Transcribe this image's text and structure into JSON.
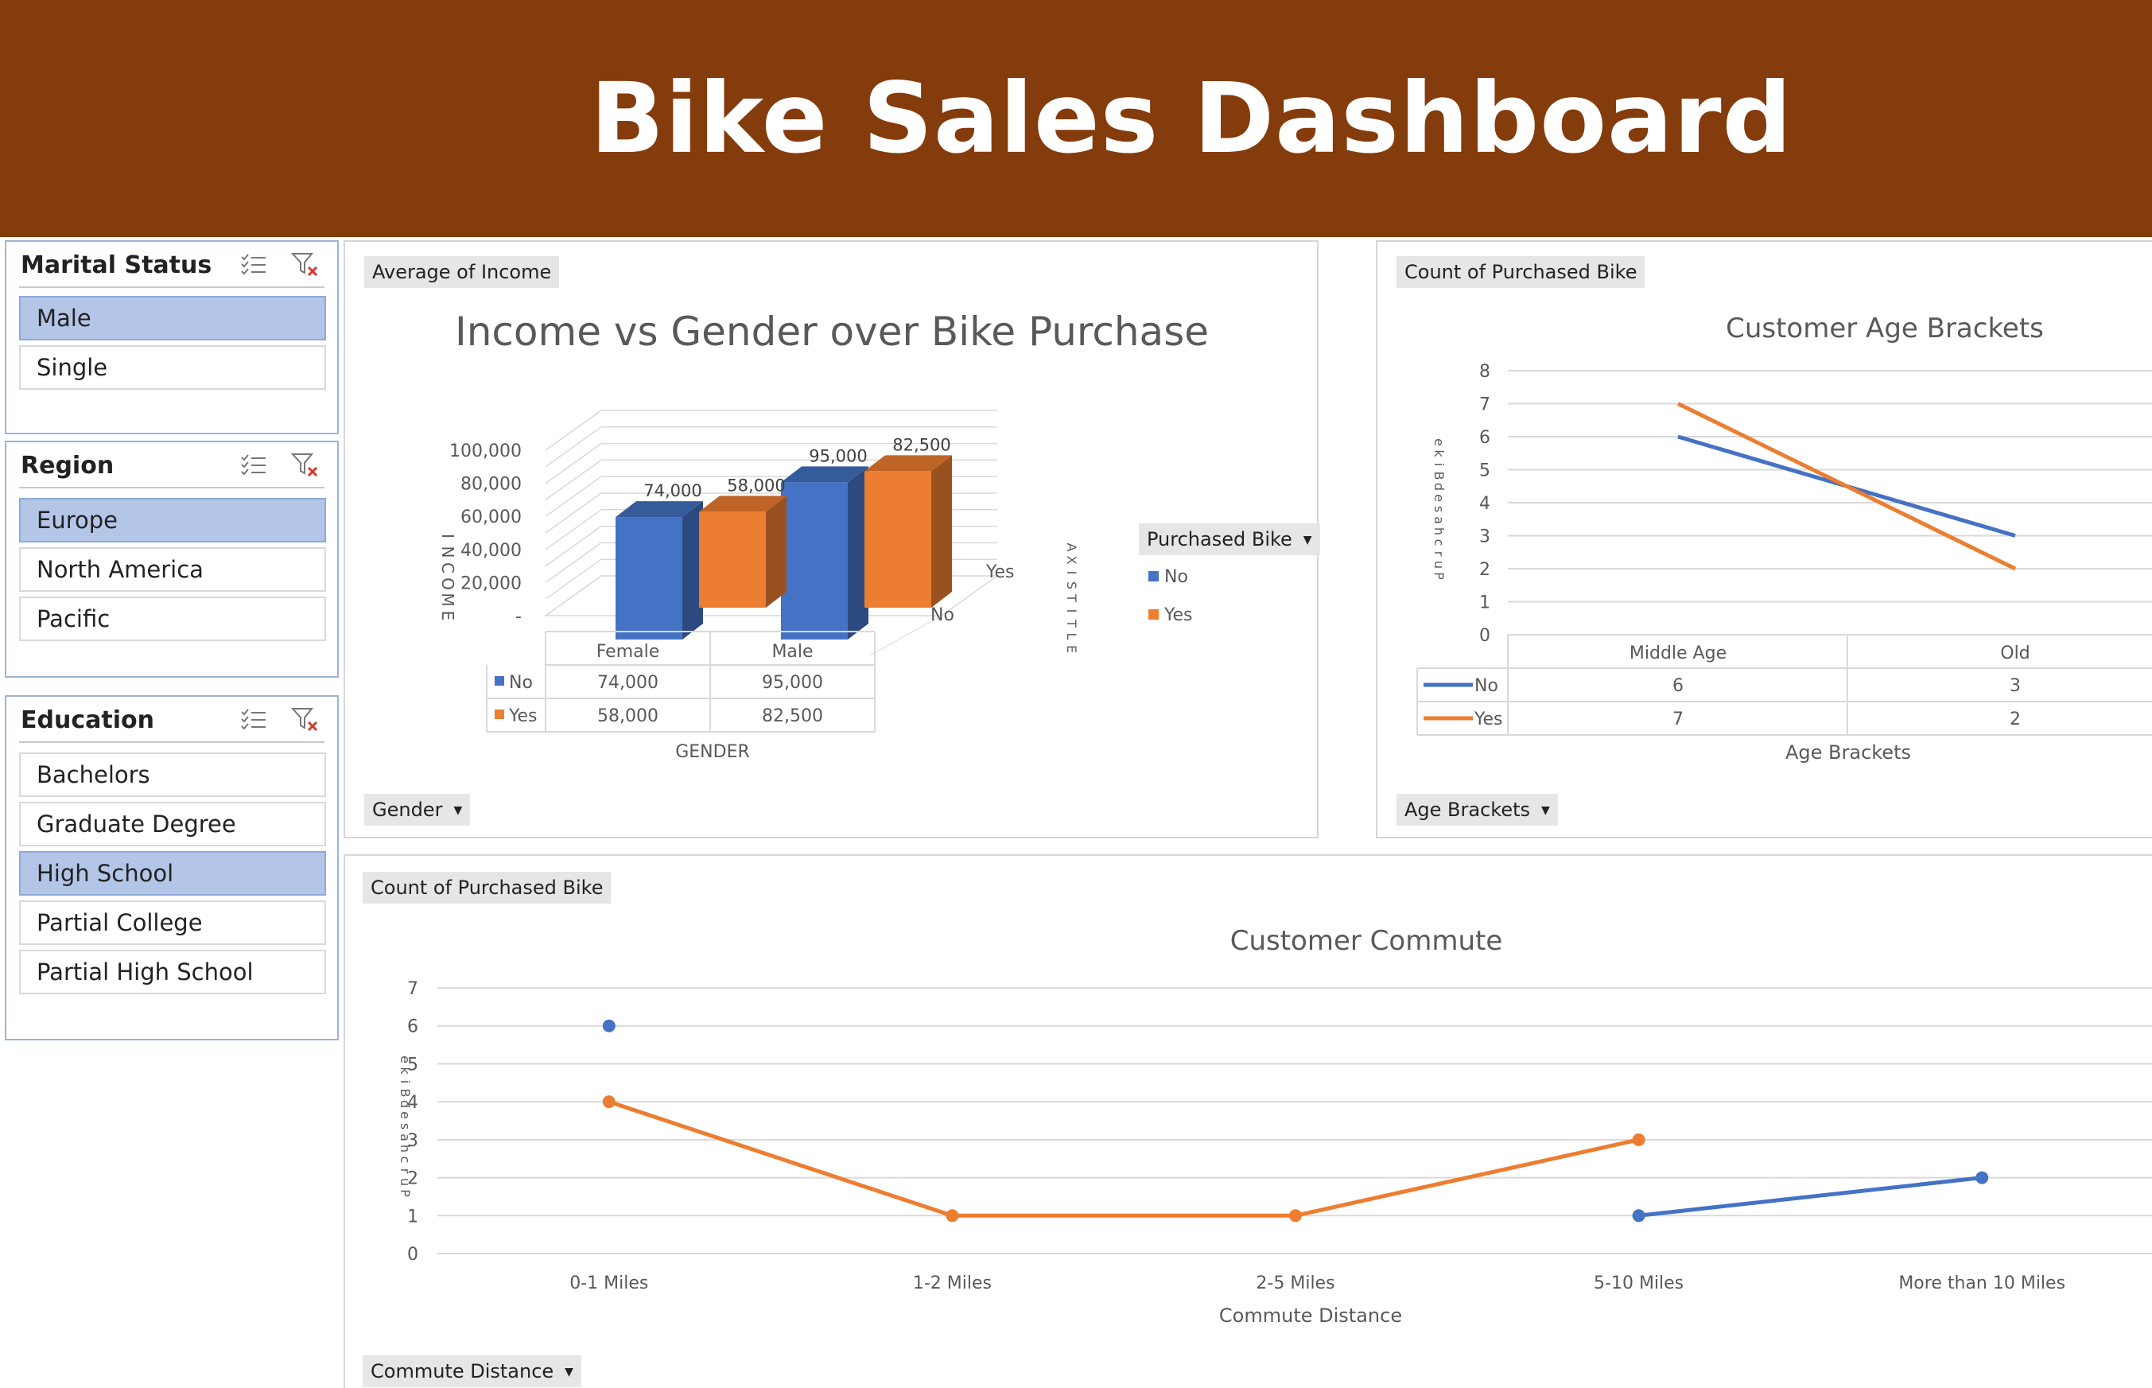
{
  "header": {
    "title": "Bike Sales Dashboard"
  },
  "slicers": {
    "marital_status": {
      "title": "Marital Status",
      "items": [
        {
          "label": "Male",
          "selected": true
        },
        {
          "label": "Single",
          "selected": false
        }
      ]
    },
    "region": {
      "title": "Region",
      "items": [
        {
          "label": "Europe",
          "selected": true
        },
        {
          "label": "North America",
          "selected": false
        },
        {
          "label": "Pacific",
          "selected": false
        }
      ]
    },
    "education": {
      "title": "Education",
      "items": [
        {
          "label": "Bachelors",
          "selected": false
        },
        {
          "label": "Graduate Degree",
          "selected": false
        },
        {
          "label": "High School",
          "selected": true
        },
        {
          "label": "Partial College",
          "selected": false
        },
        {
          "label": "Partial High School",
          "selected": false
        }
      ]
    }
  },
  "income_panel": {
    "value_button": "Average of Income",
    "axis_button": "Gender",
    "legend_button": "Purchased Bike",
    "title": "Income vs Gender over Bike Purchase",
    "y_axis_label": "INCOME",
    "x_axis_label": "GENDER",
    "series_axis_label": "AXIS TITLE",
    "y_ticks": [
      "100,000",
      "80,000",
      "60,000",
      "40,000",
      "20,000",
      "-"
    ],
    "depth_labels": [
      "Yes",
      "No"
    ],
    "table_header": [
      "Female",
      "Male"
    ],
    "table_rows": [
      {
        "name": "No",
        "values": [
          "74,000",
          "95,000"
        ]
      },
      {
        "name": "Yes",
        "values": [
          "58,000",
          "82,500"
        ]
      }
    ],
    "data_labels": [
      "74,000",
      "58,000",
      "95,000",
      "82,500"
    ],
    "legend": [
      "No",
      "Yes"
    ]
  },
  "age_panel": {
    "value_button": "Count of Purchased Bike",
    "axis_button": "Age Brackets",
    "title": "Customer Age Brackets",
    "x_axis_label": "Age Brackets",
    "y_axis_label": "Purchased Bike",
    "y_ticks": [
      "8",
      "7",
      "6",
      "5",
      "4",
      "3",
      "2",
      "1",
      "0"
    ],
    "table_header": [
      "Middle Age",
      "Old"
    ],
    "table_rows": [
      {
        "name": "No",
        "values": [
          "6",
          "3"
        ]
      },
      {
        "name": "Yes",
        "values": [
          "7",
          "2"
        ]
      }
    ]
  },
  "commute_panel": {
    "value_button": "Count of Purchased Bike",
    "axis_button": "Commute Distance",
    "title": "Customer Commute",
    "x_axis_label": "Commute  Distance",
    "y_axis_label": "Purchased Bike",
    "y_ticks": [
      "7",
      "6",
      "5",
      "4",
      "3",
      "2",
      "1",
      "0"
    ],
    "categories": [
      "0-1 Miles",
      "1-2 Miles",
      "2-5 Miles",
      "5-10 Miles",
      "More than 10 Miles"
    ]
  },
  "colors": {
    "banner": "#843c0c",
    "no": "#4472c4",
    "yes": "#ed7d31",
    "selected": "#b4c6e7"
  },
  "chart_data": [
    {
      "type": "bar",
      "title": "Income vs Gender over Bike Purchase",
      "xlabel": "GENDER",
      "ylabel": "INCOME",
      "categories": [
        "Female",
        "Male"
      ],
      "series": [
        {
          "name": "No",
          "values": [
            74000,
            95000
          ]
        },
        {
          "name": "Yes",
          "values": [
            58000,
            82500
          ]
        }
      ],
      "ylim": [
        0,
        100000
      ],
      "legend": "right"
    },
    {
      "type": "line",
      "title": "Customer Age Brackets",
      "xlabel": "Age Brackets",
      "categories": [
        "Middle Age",
        "Old"
      ],
      "series": [
        {
          "name": "No",
          "values": [
            6,
            3
          ]
        },
        {
          "name": "Yes",
          "values": [
            7,
            2
          ]
        }
      ],
      "ylim": [
        0,
        8
      ]
    },
    {
      "type": "line",
      "title": "Customer Commute",
      "xlabel": "Commute  Distance",
      "categories": [
        "0-1 Miles",
        "1-2 Miles",
        "2-5 Miles",
        "5-10 Miles",
        "More than 10 Miles"
      ],
      "series": [
        {
          "name": "No",
          "values": [
            6,
            null,
            null,
            1,
            2
          ]
        },
        {
          "name": "Yes",
          "values": [
            4,
            1,
            1,
            3,
            null
          ]
        }
      ],
      "ylim": [
        0,
        7
      ]
    }
  ]
}
